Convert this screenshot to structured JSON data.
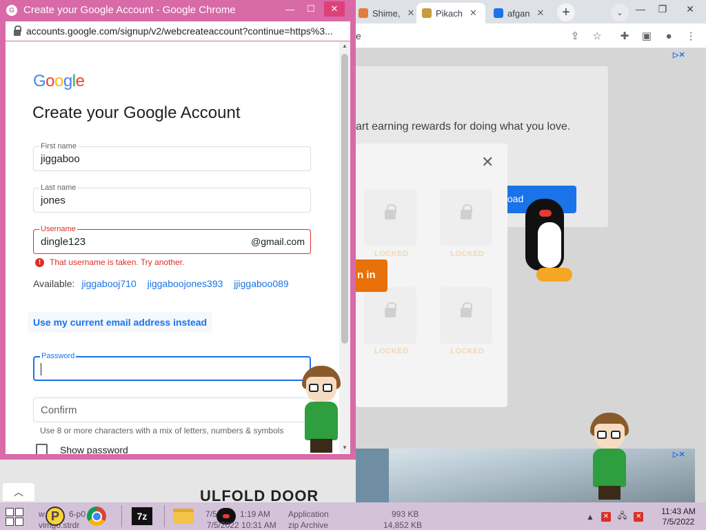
{
  "background_browser": {
    "tabs": [
      {
        "label": "Shime,",
        "favicon_color": "#e57b3c",
        "active": false
      },
      {
        "label": "Pikach",
        "favicon_color": "#c89b3c",
        "active": true
      },
      {
        "label": "afgan",
        "favicon_color": "#1a73e8",
        "active": false
      }
    ],
    "address_fragment": "e",
    "rewards_text": "art earning rewards for doing what you love.",
    "download_button_text": "oad",
    "signin_button_text": "n in",
    "locked_label": "LOCKED",
    "ad_text": "ULFOLD DOOR",
    "ad_choice_label": "▷✕"
  },
  "popup": {
    "window_title": "Create your Google Account - Google Chrome",
    "url": "accounts.google.com/signup/v2/webcreateaccount?continue=https%3...",
    "logo_letters": [
      {
        "char": "G",
        "color": "#4285F4"
      },
      {
        "char": "o",
        "color": "#EA4335"
      },
      {
        "char": "o",
        "color": "#FBBC05"
      },
      {
        "char": "g",
        "color": "#4285F4"
      },
      {
        "char": "l",
        "color": "#34A853"
      },
      {
        "char": "e",
        "color": "#EA4335"
      }
    ],
    "form": {
      "title": "Create your Google Account",
      "first_name": {
        "label": "First name",
        "value": "jiggaboo"
      },
      "last_name": {
        "label": "Last name",
        "value": "jones"
      },
      "username": {
        "label": "Username",
        "value": "dingle123",
        "suffix": "@gmail.com"
      },
      "username_error": "That username is taken. Try another.",
      "available_label": "Available:",
      "suggestions": [
        "jiggabooj710",
        "jiggaboojones393",
        "jjiggaboo089"
      ],
      "use_current_email": "Use my current email address instead",
      "password": {
        "label": "Password",
        "value": ""
      },
      "confirm": {
        "placeholder": "Confirm"
      },
      "password_hint": "Use 8 or more characters with a mix of letters, numbers & symbols",
      "show_password_label": "Show password"
    }
  },
  "taskbar": {
    "ghost_texts": [
      "w",
      "6-p0",
      "7/5",
      "1:19 AM",
      "Application",
      "993 KB",
      "vimgo.strdr",
      "7/5/2022 10:31 AM",
      "zip Archive",
      "14,852 KB"
    ],
    "clock_time": "11:43 AM",
    "clock_date": "7/5/2022",
    "app_7z_label": "7z",
    "app_p_label": "P"
  },
  "colors": {
    "popup_frame": "#d86aa8",
    "error_red": "#d93025",
    "focus_blue": "#1a73e8",
    "taskbar": "#d4c2d9"
  }
}
